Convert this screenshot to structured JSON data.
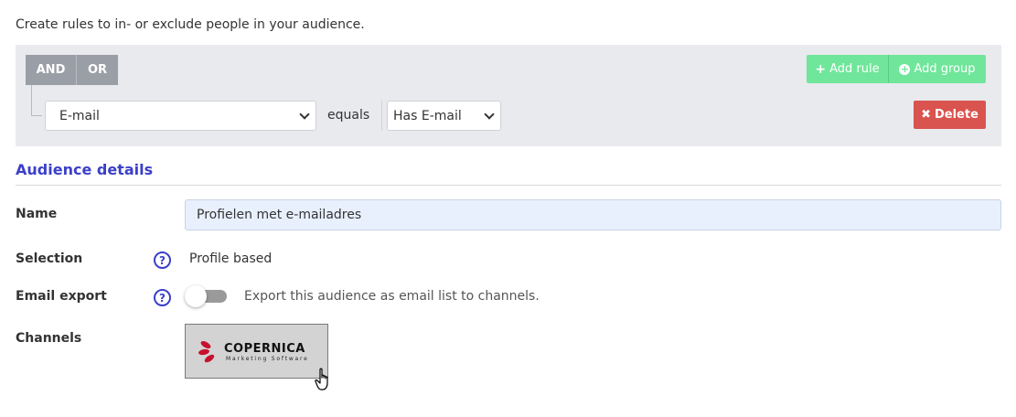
{
  "intro": "Create rules to in- or exclude people in your audience.",
  "rules": {
    "logic": {
      "and": "AND",
      "or": "OR",
      "selected": "AND"
    },
    "field_select": "E-mail",
    "operator": "equals",
    "value_select": "Has E-mail",
    "add_rule": "Add rule",
    "add_group": "Add group",
    "delete": "Delete"
  },
  "details": {
    "title": "Audience details",
    "name_label": "Name",
    "name_value": "Profielen met e-mailadres",
    "selection_label": "Selection",
    "selection_value": "Profile based",
    "email_export_label": "Email export",
    "email_export_on": false,
    "email_export_desc": "Export this audience as email list to channels.",
    "channels_label": "Channels",
    "channel_logo_name": "COPERNICA",
    "channel_logo_sub": "Marketing Software"
  },
  "colors": {
    "accent": "#3b3fc8",
    "green": "#6fe69a",
    "red": "#d9534f",
    "panel": "#e9eaee"
  },
  "icons": [
    "plus-icon",
    "circle-plus-icon",
    "x-icon",
    "help-icon",
    "chevron-down-icon",
    "hand-cursor-icon"
  ]
}
